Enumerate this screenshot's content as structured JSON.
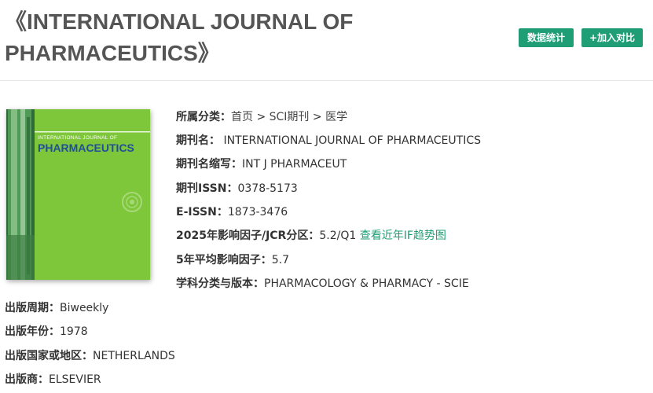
{
  "header": {
    "title_line1": "《INTERNATIONAL JOURNAL OF",
    "title_line2": "PHARMACEUTICS》",
    "stats_button": "数据统计",
    "compare_button": "+加入对比"
  },
  "cover": {
    "line1": "INTERNATIONAL JOURNAL OF",
    "line2": "PHARMACEUTICS",
    "bg_color": "#7ec63a",
    "title_color": "#1f4e9c"
  },
  "info": {
    "category_label": "所属分类：",
    "breadcrumb": [
      "首页",
      "SCI期刊",
      "医学"
    ],
    "breadcrumb_sep": " > ",
    "name_label": "期刊名：",
    "name_value": "INTERNATIONAL JOURNAL OF PHARMACEUTICS",
    "abbr_label": "期刊名缩写：",
    "abbr_value": "INT J PHARMACEUT",
    "issn_label": "期刊ISSN：",
    "issn_value": "0378-5173",
    "eissn_label": "E-ISSN：",
    "eissn_value": "1873-3476",
    "if_label": "2025年影响因子/JCR分区：",
    "if_value": "5.2/Q1",
    "if_link": "查看近年IF趋势图",
    "avg_if_label": "5年平均影响因子：",
    "avg_if_value": "5.7",
    "subject_label": "学科分类与版本：",
    "subject_value": "PHARMACOLOGY & PHARMACY - SCIE",
    "freq_label": "出版周期：",
    "freq_value": "Biweekly",
    "year_label": "出版年份：",
    "year_value": "1978",
    "country_label": "出版国家或地区：",
    "country_value": "NETHERLANDS",
    "publisher_label": "出版商：",
    "publisher_value": "ELSEVIER"
  },
  "colors": {
    "accent": "#1f9e75",
    "title": "#555555"
  }
}
